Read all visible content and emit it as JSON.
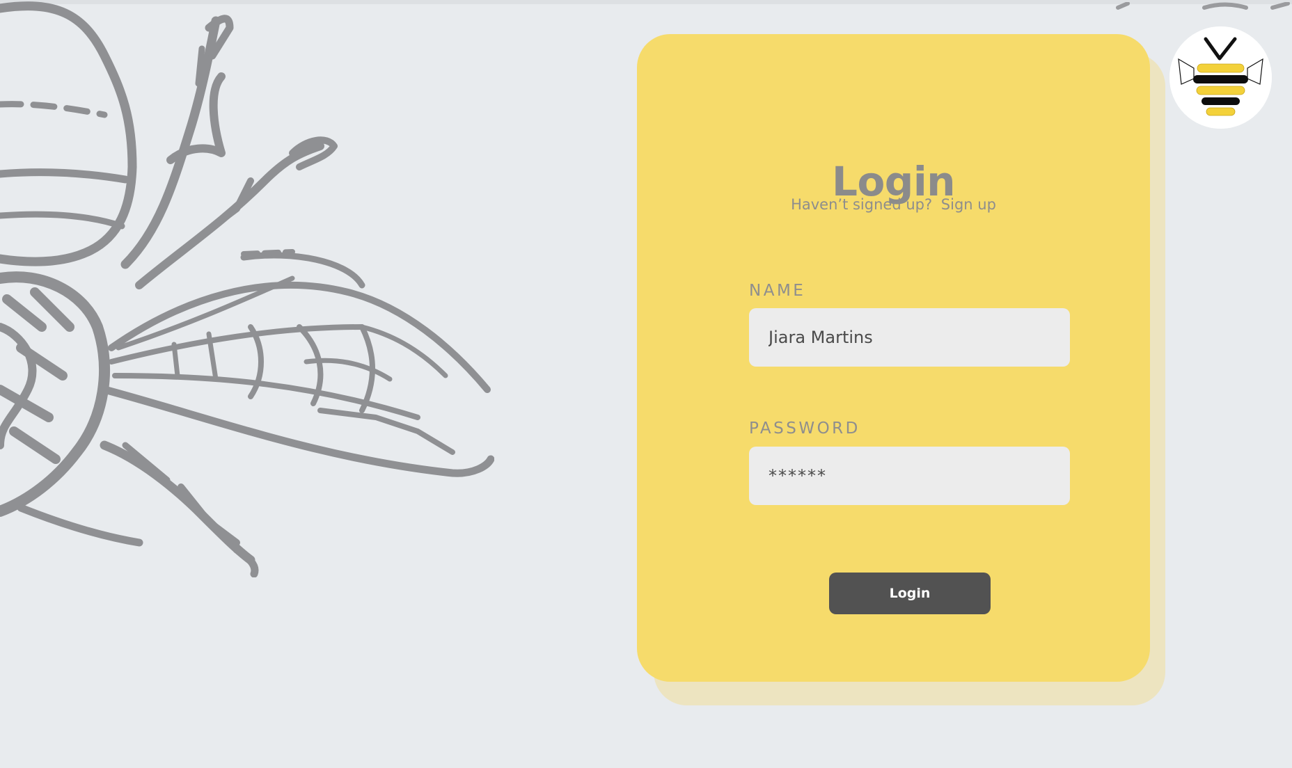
{
  "login_card": {
    "title": "Login",
    "signup_prompt": "Haven’t signed up?",
    "signup_link": "Sign up",
    "name_label": "NAME",
    "name_value": "Jiara Martins",
    "password_label": "PASSWORD",
    "password_value": "******",
    "login_button": "Login"
  },
  "colors": {
    "background": "#e8ebee",
    "card": "#f6db6b",
    "card_shadow": "#ede4c0",
    "input": "#ececec",
    "button": "#525252",
    "illustration": "#8f9093"
  },
  "icons": {
    "logo": "bee-logo-icon",
    "illustration": "bee-illustration"
  }
}
